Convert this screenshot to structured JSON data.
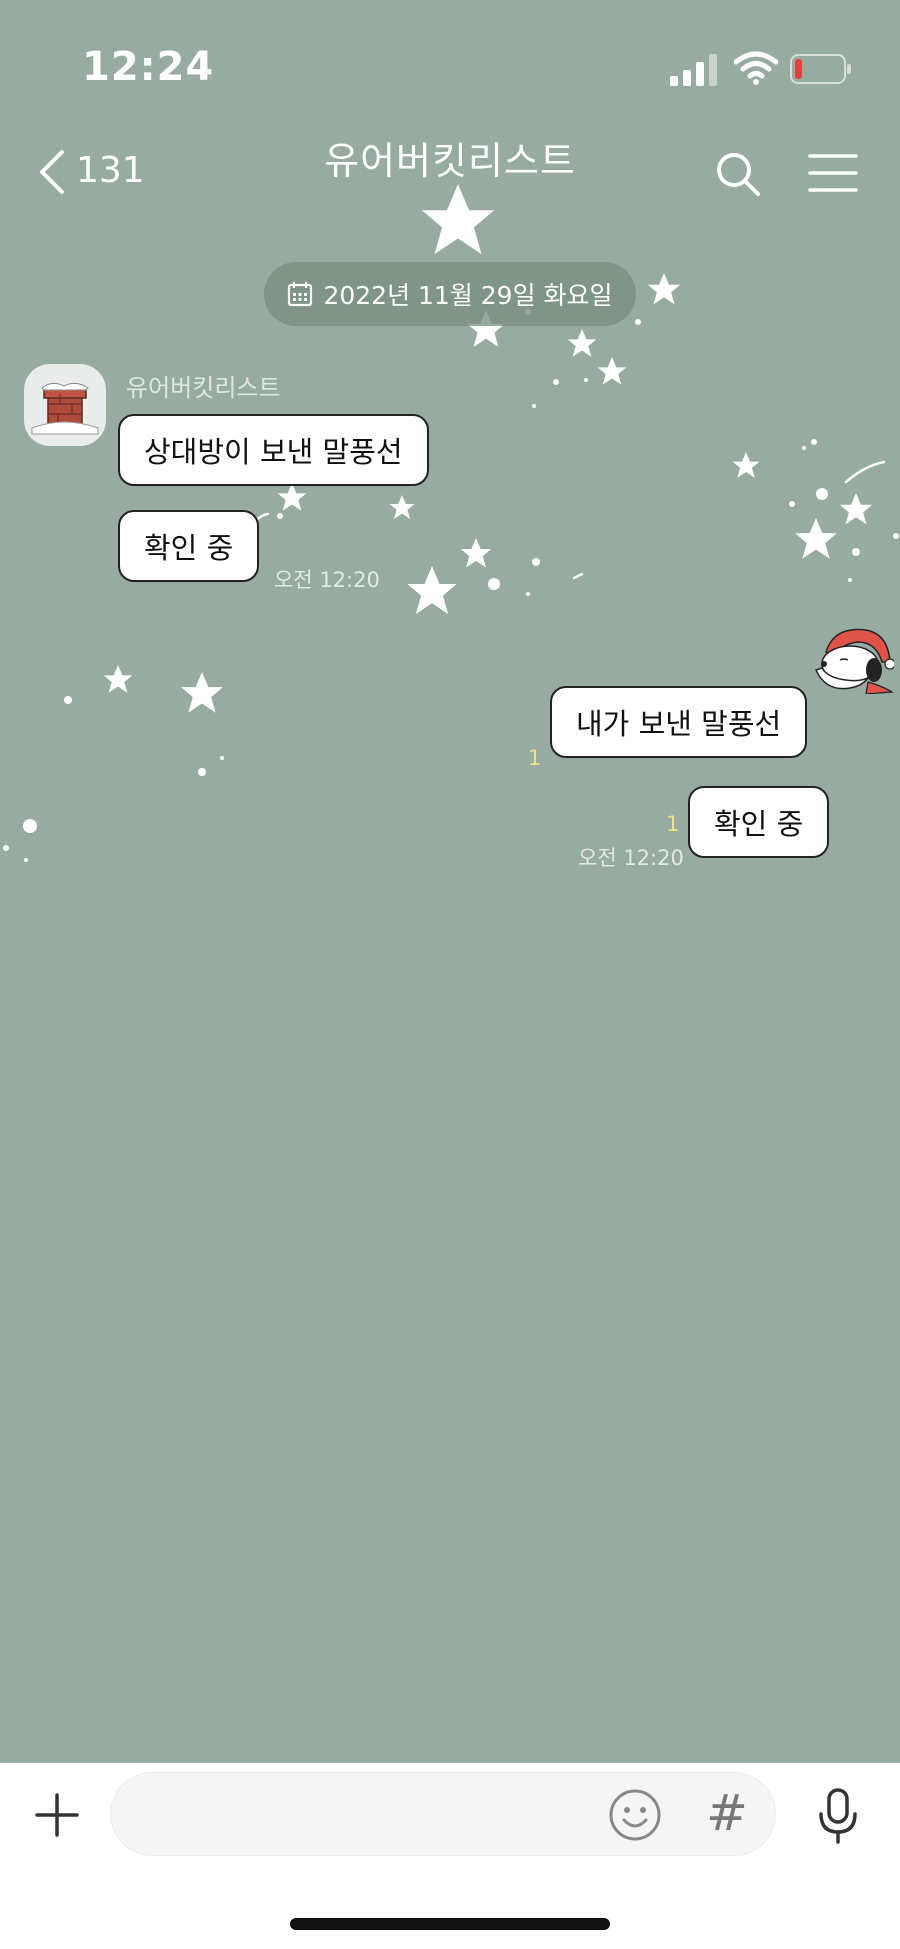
{
  "status_bar": {
    "time": "12:24"
  },
  "header": {
    "back_count": "131",
    "title": "유어버킷리스트"
  },
  "date_divider": "2022년 11월 29일 화요일",
  "messages": {
    "received": {
      "sender": "유어버킷리스트",
      "bubble_1": "상대방이 보낸 말풍선",
      "bubble_2": "확인 중",
      "time": "오전 12:20"
    },
    "sent": {
      "bubble_1": "내가 보낸 말풍선",
      "bubble_1_unread": "1",
      "bubble_2": "확인 중",
      "bubble_2_unread": "1",
      "time": "오전 12:20"
    }
  },
  "input": {
    "placeholder": "",
    "value": ""
  },
  "colors": {
    "background": "#97aba0",
    "bubble": "#ffffff",
    "unread": "#f2e08a",
    "input_bar": "#ffffff"
  },
  "icons": [
    "signal-icon",
    "wifi-icon",
    "battery-icon",
    "back-icon",
    "search-icon",
    "menu-icon",
    "calendar-icon",
    "plus-icon",
    "emoji-icon",
    "hash-icon",
    "mic-icon",
    "santa-sticker-icon",
    "chimney-avatar-icon"
  ]
}
